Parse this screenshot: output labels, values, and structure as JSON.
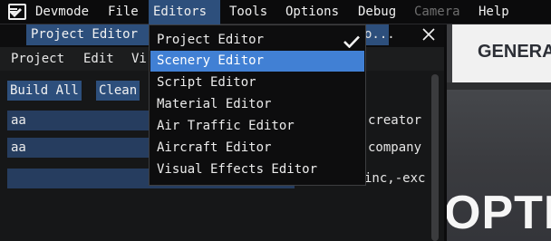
{
  "menubar": {
    "items": [
      {
        "label": "Devmode"
      },
      {
        "label": "File"
      },
      {
        "label": "Editors"
      },
      {
        "label": "Tools"
      },
      {
        "label": "Options"
      },
      {
        "label": "Debug"
      },
      {
        "label": "Camera"
      },
      {
        "label": "Help"
      }
    ]
  },
  "project_editor": {
    "title": "Project Editor",
    "title_tail": "o...",
    "menu": [
      {
        "label": "Project"
      },
      {
        "label": "Edit"
      },
      {
        "label": "Vi"
      }
    ],
    "buttons": {
      "build_all": "Build All",
      "clean": "Clean"
    },
    "fields": [
      {
        "value": "aa",
        "label": "creator"
      },
      {
        "value": "aa",
        "label": "company"
      },
      {
        "value": "",
        "label": "inc,-exc"
      }
    ]
  },
  "editors_menu": {
    "items": [
      {
        "label": "Project Editor",
        "checked": true
      },
      {
        "label": "Scenery Editor",
        "highlighted": true
      },
      {
        "label": "Script Editor"
      },
      {
        "label": "Material Editor"
      },
      {
        "label": "Air Traffic Editor"
      },
      {
        "label": "Aircraft Editor"
      },
      {
        "label": "Visual Effects Editor"
      }
    ]
  },
  "scene": {
    "sign_text": "GENERA",
    "big_text": "OPTI"
  },
  "colors": {
    "accent": "#2d4f7c",
    "highlight": "#4180d4",
    "menubar_bg": "#0b0b0c"
  }
}
